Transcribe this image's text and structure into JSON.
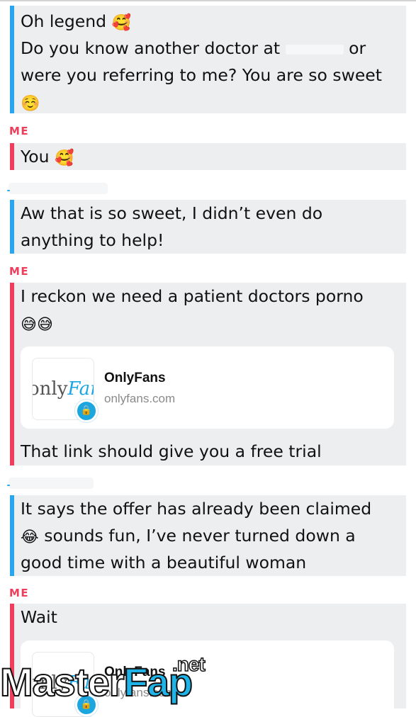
{
  "colors": {
    "other_bar": "#2aa6ee",
    "me_bar": "#ef3e5c",
    "me_label": "#ef3e5c",
    "bubble_bg": "#eceeef",
    "link_blue": "#1aa6e6"
  },
  "sender_me_label": "ME",
  "messages": [
    {
      "sender": "other",
      "lines": [
        "Oh legend",
        "Do you know another doctor at",
        "or",
        "were you referring to me? You are so sweet"
      ],
      "emojis": [
        "smiling-face-with-hearts",
        "smiling-face"
      ]
    },
    {
      "sender": "me",
      "lines": [
        "You"
      ],
      "emojis": [
        "smiling-face-with-hearts"
      ]
    },
    {
      "sender": "other",
      "lines": [
        "Aw that is so sweet, I didn’t even do",
        "anything to help!"
      ]
    },
    {
      "sender": "me",
      "lines": [
        "I reckon we need a patient doctors porno",
        "That link should give you a free trial"
      ],
      "emojis": [
        "grinning-sweat",
        "grinning-sweat"
      ],
      "link": {
        "title": "OnlyFans",
        "url": "onlyfans.com",
        "logo_text_a": "only",
        "logo_text_b": "Fans"
      }
    },
    {
      "sender": "other",
      "lines": [
        "It says the offer has already been claimed",
        "sounds fun, I’ve never turned down a",
        "good time with a beautiful woman"
      ],
      "emojis": [
        "face-with-tears-of-joy"
      ]
    },
    {
      "sender": "me",
      "lines": [
        "Wait"
      ],
      "link": {
        "title": "OnlyFans",
        "url": "onlyfans.com",
        "logo_text_a": "only",
        "logo_text_b": "Fans"
      }
    }
  ],
  "icons": {
    "lock": "lock-icon"
  },
  "watermark": {
    "part1": "Master",
    "part2": "Fap",
    "part3": ".net"
  }
}
